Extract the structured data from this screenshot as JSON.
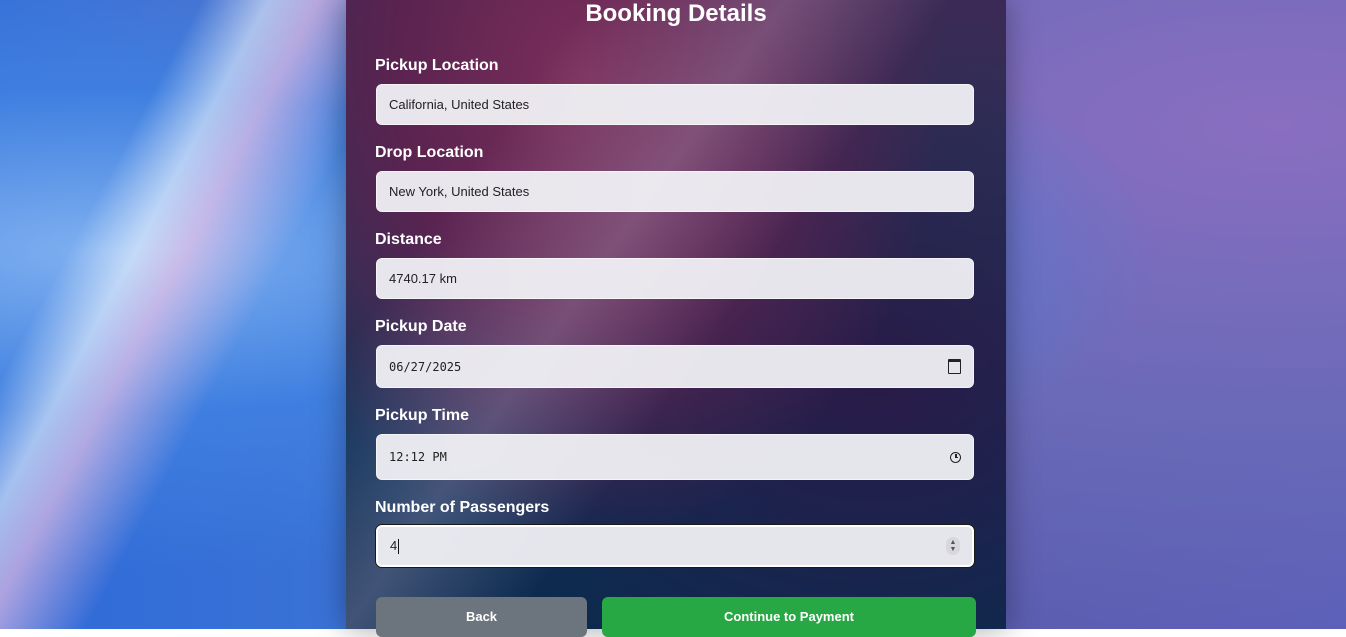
{
  "form": {
    "title": "Booking Details",
    "pickup_location": {
      "label": "Pickup Location",
      "value": "California, United States"
    },
    "drop_location": {
      "label": "Drop Location",
      "value": "New York, United States"
    },
    "distance": {
      "label": "Distance",
      "value": "4740.17 km"
    },
    "pickup_date": {
      "label": "Pickup Date",
      "value": "06/27/2025",
      "icon": "calendar-icon"
    },
    "pickup_time": {
      "label": "Pickup Time",
      "value": "12:12 PM",
      "icon": "clock-icon"
    },
    "passengers": {
      "label": "Number of Passengers",
      "value": "4"
    }
  },
  "buttons": {
    "back": "Back",
    "continue": "Continue to Payment"
  },
  "colors": {
    "back_button": "#6c757d",
    "continue_button": "#28a745"
  }
}
